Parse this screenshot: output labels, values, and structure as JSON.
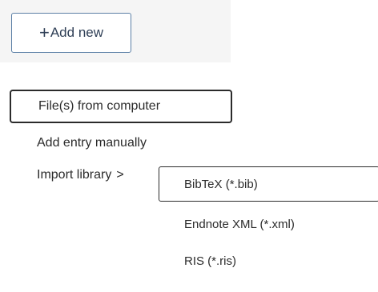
{
  "toolbar": {
    "add_new_label": "Add new",
    "add_new_icon": "+"
  },
  "menu": {
    "items": [
      {
        "label": "File(s) from computer",
        "highlighted": true
      },
      {
        "label": "Add entry manually",
        "highlighted": false
      },
      {
        "label": "Import library",
        "highlighted": false,
        "submenu_indicator": ">"
      }
    ]
  },
  "submenu": {
    "items": [
      {
        "label": "BibTeX (*.bib)",
        "highlighted": true
      },
      {
        "label": "Endnote XML (*.xml)",
        "highlighted": false
      },
      {
        "label": "RIS (*.ris)",
        "highlighted": false
      }
    ]
  },
  "colors": {
    "button_border": "#5b7fa6",
    "highlight_border": "#2b2b2b",
    "strip_background": "#f5f5f5"
  }
}
